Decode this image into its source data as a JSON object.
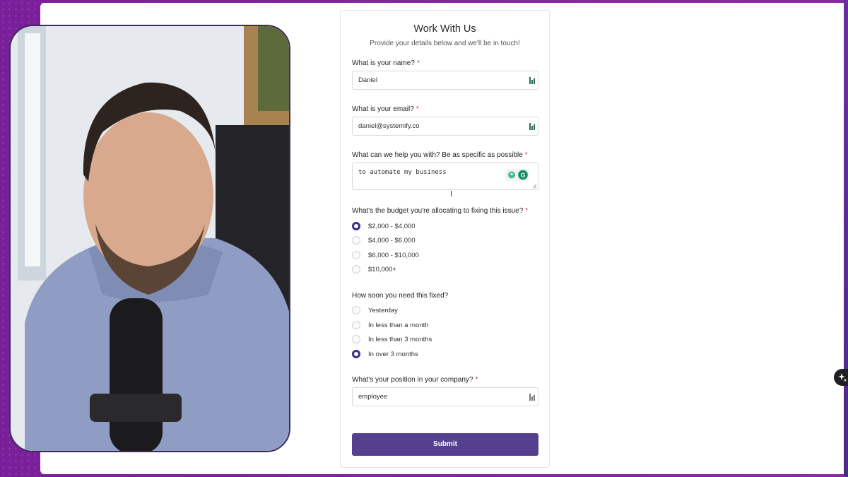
{
  "form": {
    "title": "Work With Us",
    "subtitle": "Provide your details below and we'll be in touch!",
    "required_mark": "*",
    "name": {
      "label": "What is your name?",
      "value": "Daniel"
    },
    "email": {
      "label": "What is your email?",
      "value": "daniel@systemify.co"
    },
    "help": {
      "label": "What can we help you with? Be as specific as possible",
      "value": "to automate my business"
    },
    "budget": {
      "label": "What's the budget you're allocating to fixing this issue?",
      "options": [
        "$2,000 - $4,000",
        "$4,000 - $6,000",
        "$6,000 - $10,000",
        "$10,000+"
      ],
      "selected": "$2,000 - $4,000"
    },
    "timeline": {
      "label": "How soon you need this fixed?",
      "options": [
        "Yesterday",
        "In less than a month",
        "In less than 3 months",
        "In over 3 months"
      ],
      "selected": "In over 3 months"
    },
    "position": {
      "label": "What's your position in your company?",
      "value": "employee"
    },
    "submit_label": "Submit"
  },
  "colors": {
    "accent": "#55408f",
    "radio_selected": "#3e3288",
    "required": "#d43b3b",
    "background": "#8a2aa3"
  },
  "icons": {
    "field_icon": "bar-chart-icon",
    "grammarly": "grammarly-icon",
    "ai_assist": "sparkle-icon"
  }
}
